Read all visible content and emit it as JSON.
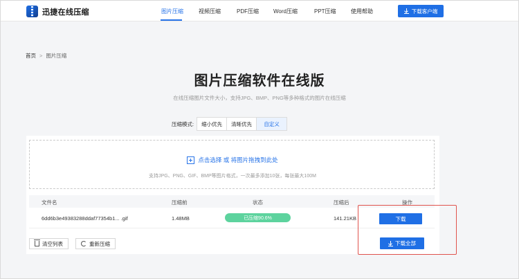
{
  "header": {
    "brand": "迅捷在线压缩",
    "nav": [
      {
        "label": "图片压缩",
        "active": true
      },
      {
        "label": "视频压缩",
        "active": false
      },
      {
        "label": "PDF压缩",
        "active": false
      },
      {
        "label": "Word压缩",
        "active": false
      },
      {
        "label": "PPT压缩",
        "active": false
      },
      {
        "label": "使用帮助",
        "active": false
      }
    ],
    "client_button": "下载客户端"
  },
  "breadcrumb": {
    "home": "首页",
    "separator": ">",
    "current": "图片压缩"
  },
  "page": {
    "title": "图片压缩软件在线版",
    "subtitle": "在线压缩图片文件大小，支持JPG、BMP、PNG等多种格式的图片在线压缩"
  },
  "mode": {
    "label": "压缩模式:",
    "options": [
      "缩小优先",
      "清晰优先",
      "自定义"
    ],
    "selected": "自定义"
  },
  "upload": {
    "prompt": "点击选择 或 将图片拖拽到此处",
    "hint": "支持JPG、PNG、GIF、BMP等图片格式，一次最多添加10张，每张最大100M"
  },
  "table": {
    "columns": [
      "文件名",
      "压缩前",
      "状态",
      "压缩后",
      "操作"
    ],
    "rows": [
      {
        "filename": "6dd6b3e49383288ddaf77354b1... .gif",
        "before": "1.48MB",
        "status": "已压缩90.6%",
        "after": "141.21KB",
        "action": "下载"
      }
    ]
  },
  "footer": {
    "clear": "清空列表",
    "recompress": "重新压缩",
    "download_all": "下载全部"
  },
  "colors": {
    "primary": "#1f6fe5",
    "success": "#5dd39e",
    "highlight": "#e0524c"
  }
}
